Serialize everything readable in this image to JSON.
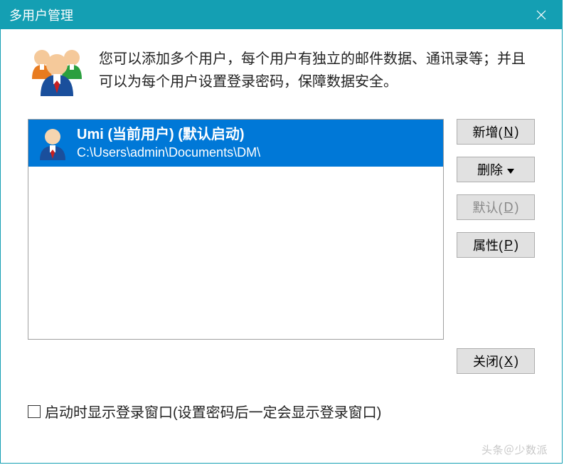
{
  "titlebar": {
    "title": "多用户管理"
  },
  "description": "您可以添加多个用户，每个用户有独立的邮件数据、通讯录等；并且可以为每个用户设置登录密码，保障数据安全。",
  "users": [
    {
      "display": "Umi (当前用户) (默认启动)",
      "path": "C:\\Users\\admin\\Documents\\DM\\"
    }
  ],
  "buttons": {
    "add_pre": "新增(",
    "add_key": "N",
    "add_post": ")",
    "del_pre": "删除 ",
    "default_pre": "默认(",
    "default_key": "D",
    "default_post": ")",
    "props_pre": "属性(",
    "props_key": "P",
    "props_post": ")",
    "close_pre": "关闭(",
    "close_key": "X",
    "close_post": ")"
  },
  "checkbox": {
    "label": "启动时显示登录窗口(设置密码后一定会显示登录窗口)"
  },
  "watermark": "头条＠少数派"
}
